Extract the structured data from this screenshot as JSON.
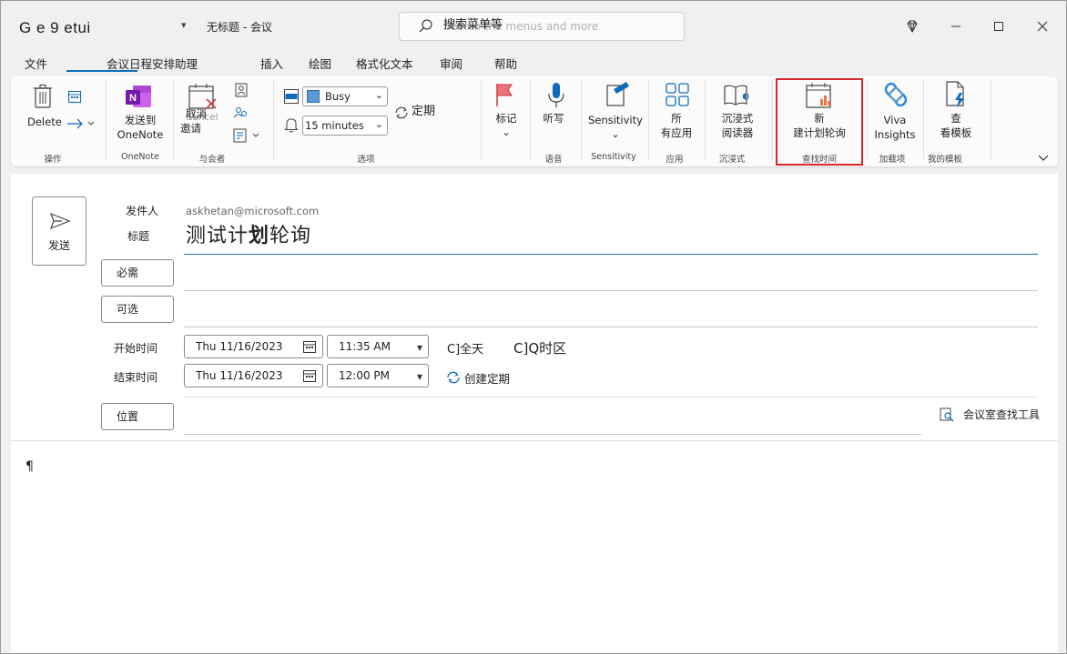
{
  "titlebar": {
    "app_title": "G e 9 etui",
    "qat_dropdown": "▾",
    "doc_title": "无标题  - 会议",
    "search_ghost": "Search the menus and more",
    "search_label": "搜索菜单等"
  },
  "tabs": [
    {
      "label": "文件"
    },
    {
      "label": "会议日程安排助理"
    },
    {
      "label": "插入"
    },
    {
      "label": "绘图"
    },
    {
      "label": "格式化文本"
    },
    {
      "label": "审阅"
    },
    {
      "label": "帮助"
    }
  ],
  "ribbon": {
    "actions": {
      "delete": "Delete",
      "group": "操作"
    },
    "onenote": {
      "send_line1": "发送到",
      "send_line2": "OneNote",
      "group": "OneNote"
    },
    "attendees": {
      "cancel_line1": "取消",
      "cancel_line2": "邀请",
      "cancel_ghost": "Cancel",
      "group": "与会者"
    },
    "options": {
      "show_as": "Busy",
      "reminder": "15 minutes",
      "recurrence": "定期",
      "group": "选项"
    },
    "tags": {
      "label": "标记",
      "group": ""
    },
    "voice": {
      "dictate": "听写",
      "group": "语音"
    },
    "sensitivity": {
      "label": "Sensitivity",
      "group": "Sensitivity"
    },
    "apps": {
      "line1": "所",
      "line2": "有应用",
      "group": "应用"
    },
    "immersive": {
      "line1": "沉浸式",
      "line2": "阅读器",
      "group": "沉浸式"
    },
    "find_time": {
      "line1": "新",
      "line2": "建计划轮询",
      "group": "查找时间"
    },
    "addins": {
      "line1": "Viva",
      "line2": "Insights",
      "group": "加载项"
    },
    "templates": {
      "line1": "查",
      "line2": "看模板",
      "group": "我的模板"
    }
  },
  "form": {
    "send": "发送",
    "from_label": "发件人",
    "from_value": "askhetan@microsoft.com",
    "subject_label": "标题",
    "subject_part1": "测试计",
    "subject_bold": "划",
    "subject_part2": "轮询",
    "required": "必需",
    "optional": "可选",
    "start_label": "开始时间",
    "end_label": "结束时间",
    "start_date": "Thu 11/16/2023",
    "start_time": "11:35 AM",
    "end_date": "Thu 11/16/2023",
    "end_time": "12:00 PM",
    "all_day": "C]全天",
    "timezone": "C]Q时区",
    "make_recurring": "创建定期",
    "location": "位置",
    "room_finder": "会议室查找工具",
    "pilcrow": "¶"
  },
  "colors": {
    "accent": "#0f6cbd",
    "highlight": "#d7262c",
    "onenote": "#7719aa"
  }
}
